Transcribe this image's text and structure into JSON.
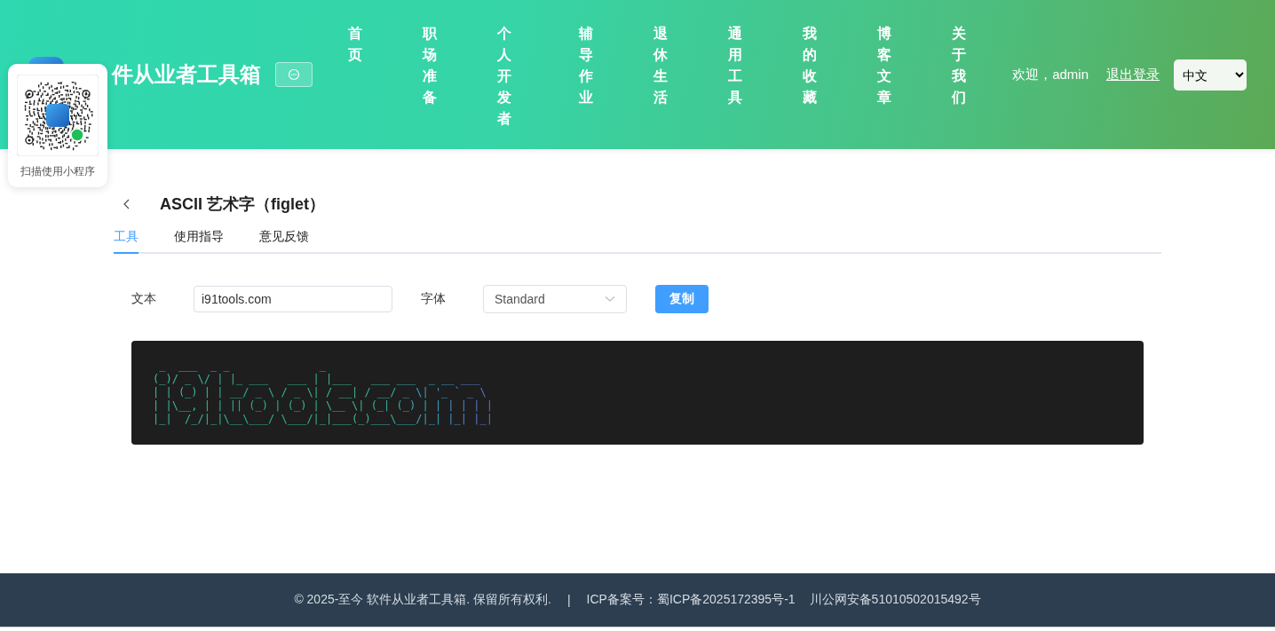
{
  "header": {
    "site_title": "件从业者工具箱",
    "nav": [
      {
        "label": "首页"
      },
      {
        "label": "职场准备"
      },
      {
        "label": "个人开发者"
      },
      {
        "label": "辅导作业"
      },
      {
        "label": "退休生活"
      },
      {
        "label": "通用工具"
      },
      {
        "label": "我的收藏"
      },
      {
        "label": "博客文章"
      },
      {
        "label": "关于我们"
      }
    ],
    "welcome": "欢迎，admin",
    "logout": "退出登录",
    "language": "中文"
  },
  "qr_popup": {
    "caption": "扫描使用小程序"
  },
  "page": {
    "title": "ASCII 艺术字（figlet）",
    "tabs": [
      {
        "label": "工具",
        "selected": true
      },
      {
        "label": "使用指导",
        "selected": false
      },
      {
        "label": "意见反馈",
        "selected": false
      }
    ],
    "form": {
      "text_label": "文本",
      "text_value": "i91tools.com",
      "font_label": "字体",
      "font_value": "Standard",
      "copy_button": "复制"
    },
    "ascii_art": [
      " _  ___  _ _              _                         ",
      "(_)/ _ \\/ | |_ ___   ___ | |___   ___ ___  _ __ ___  ",
      "| | (_) | | __/ _ \\ / _ \\| / __| / __/ _ \\| '_ ` _ \\ ",
      "| |\\__, | | || (_) | (_) | \\__ \\| (_| (_) | | | | | |",
      "|_|  /_/|_|\\__\\___/ \\___/|_|___(_)___\\___/|_| |_| |_|"
    ]
  },
  "footer": {
    "copyright": "© 2025-至今 软件从业者工具箱. 保留所有权利.",
    "separator": "|",
    "icp": "ICP备案号：蜀ICP备2025172395号-1",
    "police": "川公网安备51010502015492号"
  }
}
